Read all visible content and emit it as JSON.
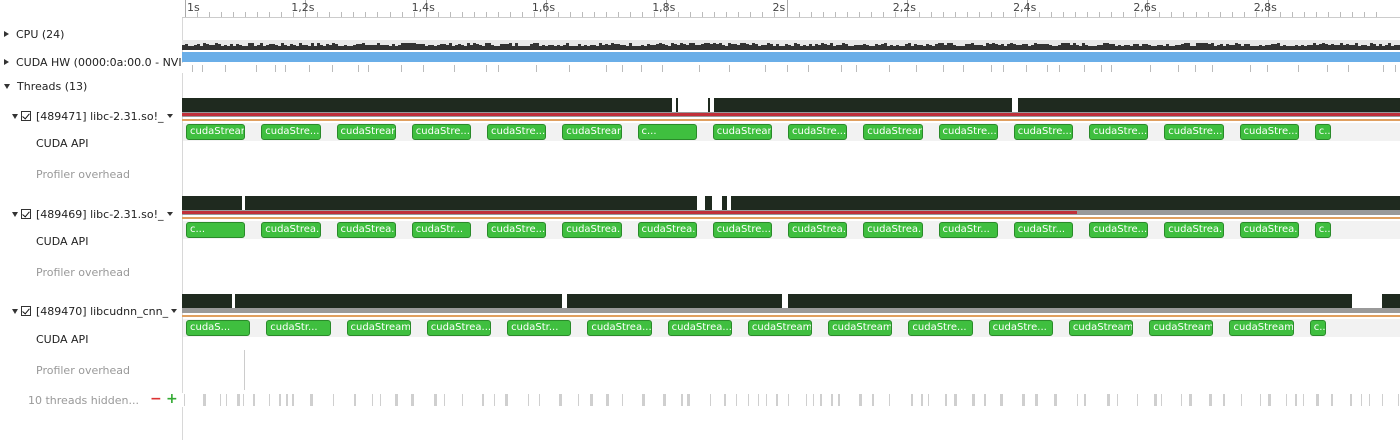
{
  "ruler": {
    "ticks": [
      {
        "label": "1s"
      },
      {
        "label": "1,2s"
      },
      {
        "label": "1,4s"
      },
      {
        "label": "1,6s"
      },
      {
        "label": "1,8s"
      },
      {
        "label": "2s"
      },
      {
        "label": "2,2s"
      },
      {
        "label": "2,4s"
      },
      {
        "label": "2,6s"
      },
      {
        "label": "2,8s"
      }
    ]
  },
  "rows": {
    "cpu": "CPU (24)",
    "cuda_hw": "CUDA HW (0000:0a:00.0 - NVI",
    "threads": "Threads (13)",
    "thread1": "[489471] libc-2.31.so!_",
    "thread2": "[489469] libc-2.31.so!_",
    "thread3": "[489470] libcudnn_cnn_",
    "cuda_api": "CUDA API",
    "profiler_overhead": "Profiler overhead",
    "hidden": "10 threads hidden..."
  },
  "threads": [
    {
      "cuda_blocks": [
        "cudaStream...",
        "cudaStre...",
        "cudaStream...",
        "cudaStre...",
        "cudaStre...",
        "cudaStream...",
        "c...",
        "cudaStream...",
        "cudaStre...",
        "cudaStream...",
        "cudaStre...",
        "cudaStre...",
        "cudaStre...",
        "cudaStre...",
        "cudaStre...",
        "c..."
      ]
    },
    {
      "cuda_blocks": [
        "c...",
        "cudaStrea...",
        "cudaStrea...",
        "cudaStr...",
        "cudaStre...",
        "cudaStrea...",
        "cudaStrea...",
        "cudaStre...",
        "cudaStrea...",
        "cudaStrea...",
        "cudaStr...",
        "cudaStr...",
        "cudaStre...",
        "cudaStrea...",
        "cudaStrea...",
        "c..."
      ]
    },
    {
      "cuda_blocks": [
        "cudaS...",
        "cudaStr...",
        "cudaStream...",
        "cudaStrea...",
        "cudaStr...",
        "cudaStrea...",
        "cudaStrea...",
        "cudaStream...",
        "cudaStream...",
        "cudaStre...",
        "cudaStre...",
        "cudaStream...",
        "cudaStream...",
        "cudaStream...",
        "c..."
      ]
    }
  ],
  "colors": {
    "cuda_green": "#3fbf3f",
    "cuda_hw_blue": "#6aaee8",
    "cpu_dark": "#333333",
    "thread_dark": "#1f2a1f",
    "thread_red": "#c0303a",
    "orange": "#e0a060"
  }
}
